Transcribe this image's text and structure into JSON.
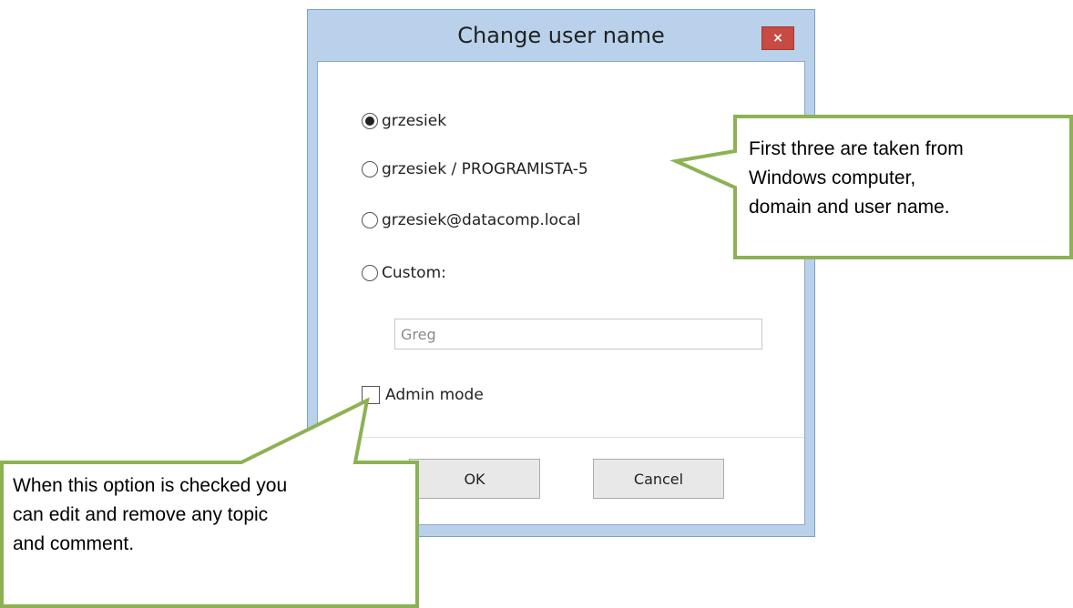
{
  "window": {
    "title": "Change user name",
    "close_label": "×"
  },
  "options": {
    "radio_1": "grzesiek",
    "radio_2": "grzesiek / PROGRAMISTA-5",
    "radio_3": "grzesiek@datacomp.local",
    "radio_4": "Custom:",
    "selected": "grzesiek"
  },
  "custom_field": {
    "value": "Greg"
  },
  "admin": {
    "label": "Admin mode",
    "checked": false
  },
  "buttons": {
    "ok": "OK",
    "cancel": "Cancel"
  },
  "callouts": {
    "top_right": {
      "line_1": "First three are taken from",
      "line_2": "Windows computer,",
      "line_3": "domain and user name."
    },
    "bottom_left": {
      "line_1": "When this option is checked you",
      "line_2": "can edit and remove any topic",
      "line_3": "and comment."
    },
    "border_color": "#8cb253"
  }
}
